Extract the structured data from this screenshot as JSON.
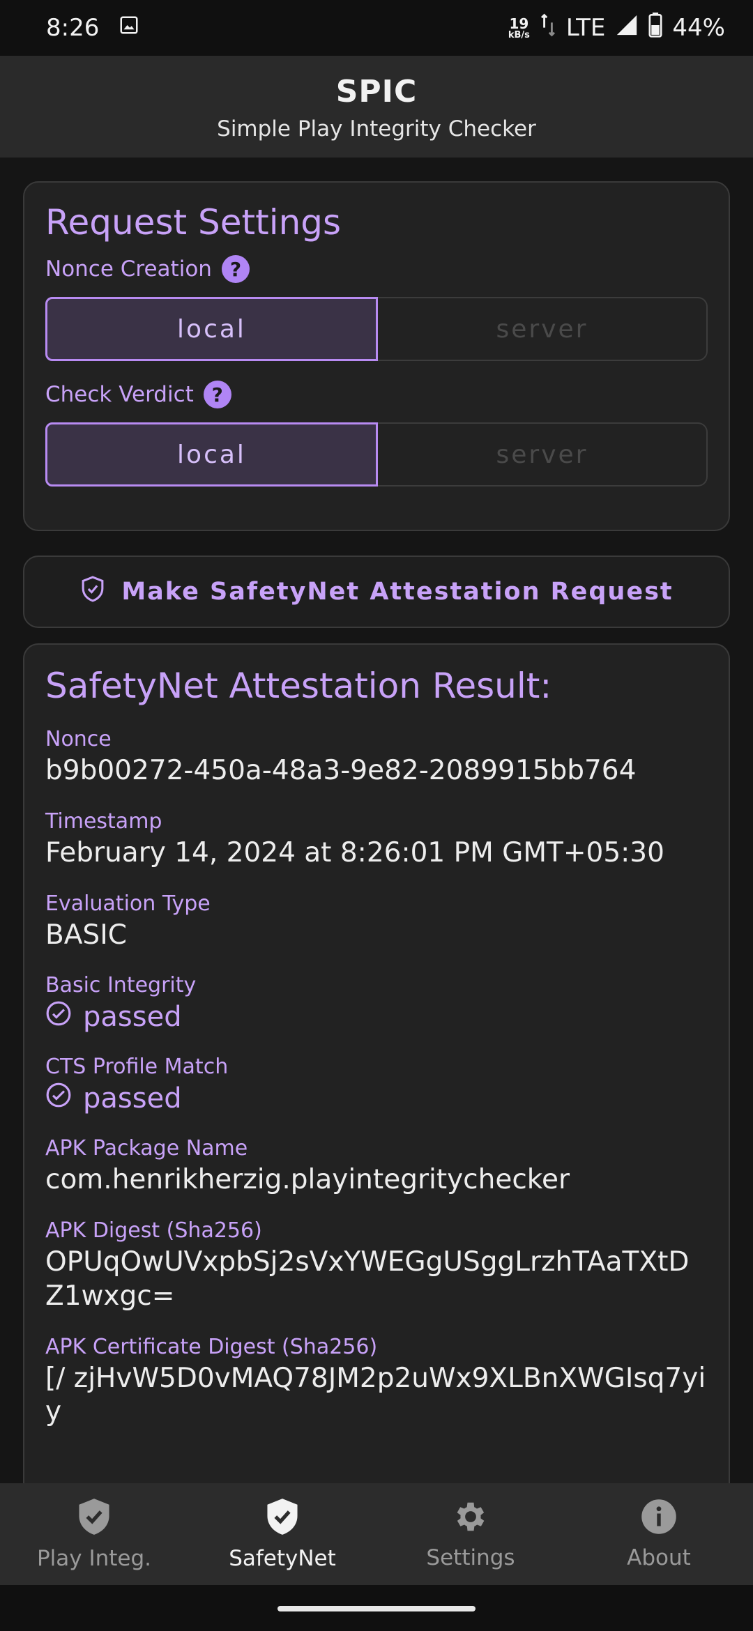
{
  "status_bar": {
    "time": "8:26",
    "speed_value": "19",
    "speed_unit": "kB/s",
    "network": "LTE",
    "battery": "44%"
  },
  "app_bar": {
    "title": "SPIC",
    "subtitle": "Simple Play Integrity Checker"
  },
  "settings": {
    "title": "Request Settings",
    "nonce": {
      "label": "Nonce Creation",
      "options": [
        "local",
        "server"
      ],
      "selected": "local"
    },
    "verdict": {
      "label": "Check Verdict",
      "options": [
        "local",
        "server"
      ],
      "selected": "local"
    },
    "help_glyph": "?"
  },
  "request_button": {
    "label": "Make SafetyNet Attestation Request",
    "icon": "shield-check-icon"
  },
  "result": {
    "title": "SafetyNet Attestation Result:",
    "fields": [
      {
        "label": "Nonce",
        "value": "b9b00272-450a-48a3-9e82-2089915bb764"
      },
      {
        "label": "Timestamp",
        "value": "February 14, 2024 at 8:26:01 PM GMT+05:30"
      },
      {
        "label": "Evaluation Type",
        "value": "BASIC"
      },
      {
        "label": "Basic Integrity",
        "value": "passed"
      },
      {
        "label": "CTS Profile Match",
        "value": "passed"
      },
      {
        "label": "APK Package Name",
        "value": "com.henrikherzig.playintegritychecker"
      },
      {
        "label": "APK Digest (Sha256)",
        "value": "OPUqOwUVxpbSj2sVxYWEGgUSggLrzhTAaTXtDZ1wxgc="
      },
      {
        "label": "APK Certificate Digest (Sha256)",
        "value": "[/ zjHvW5D0vMAQ78JM2p2uWx9XLBnXWGIsq7yiy"
      }
    ]
  },
  "bottom_nav": {
    "items": [
      {
        "label": "Play Integ.",
        "icon": "shield-check-icon"
      },
      {
        "label": "SafetyNet",
        "icon": "shield-check-icon"
      },
      {
        "label": "Settings",
        "icon": "gear-icon"
      },
      {
        "label": "About",
        "icon": "info-icon"
      }
    ],
    "active": "SafetyNet"
  },
  "colors": {
    "accent": "#C8A2F8",
    "background": "#151515",
    "card": "#222222"
  }
}
